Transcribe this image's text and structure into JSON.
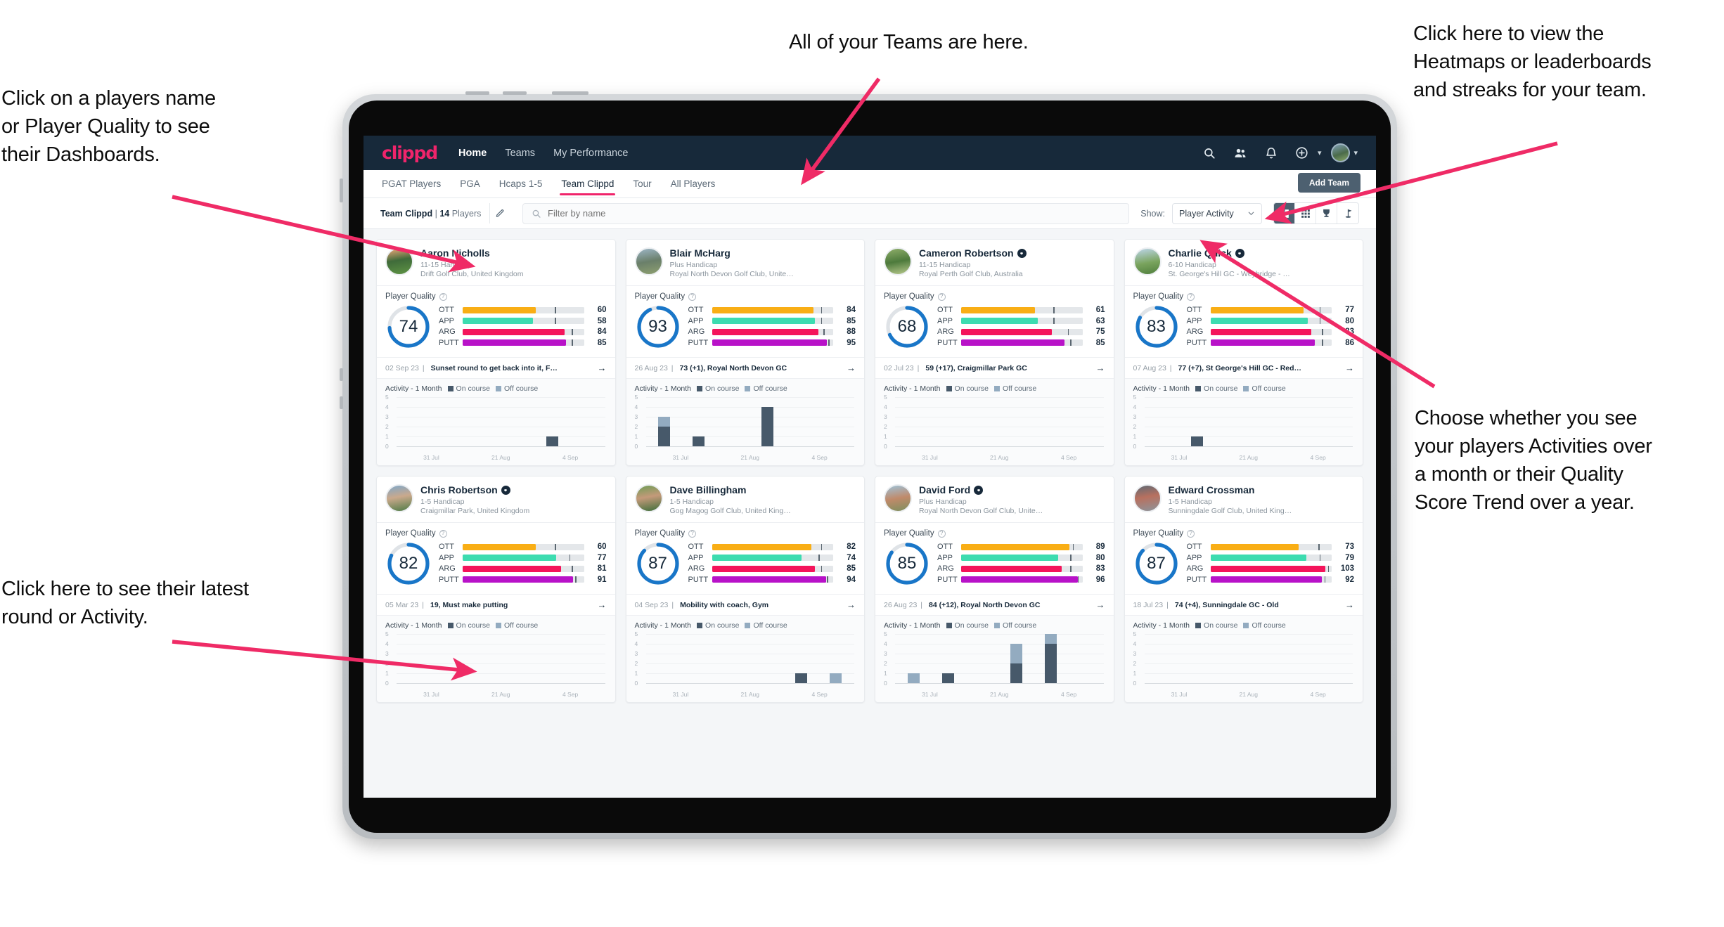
{
  "annotations": [
    {
      "id": "players-name",
      "text": "Click on a players name\nor Player Quality to see\ntheir Dashboards."
    },
    {
      "id": "teams-here",
      "text": "All of your Teams are here."
    },
    {
      "id": "heatmaps",
      "text": "Click here to view the\nHeatmaps or leaderboards\nand streaks for your team."
    },
    {
      "id": "activities-toggle",
      "text": "Choose whether you see\nyour players Activities over\na month or their Quality\nScore Trend over a year."
    },
    {
      "id": "latest-round",
      "text": "Click here to see their latest\nround or Activity."
    }
  ],
  "colors": {
    "brand_pink": "#f0246b",
    "appbar": "#17293a",
    "ott": "#f9ae15",
    "app": "#3ddcb0",
    "arg": "#f4145b",
    "putt": "#b812c8",
    "ring": "#1976c8",
    "ring_track": "#dfe3e7",
    "on_course": "#47596a",
    "off_course": "#93abc0"
  },
  "app": {
    "logo": "clippd",
    "nav": [
      {
        "label": "Home",
        "active": true
      },
      {
        "label": "Teams",
        "active": false
      },
      {
        "label": "My Performance",
        "active": false
      }
    ],
    "header_icons": [
      {
        "name": "search-icon"
      },
      {
        "name": "people-icon"
      },
      {
        "name": "bell-icon"
      },
      {
        "name": "add-circle-icon"
      }
    ],
    "tabs": [
      {
        "label": "PGAT Players",
        "active": false
      },
      {
        "label": "PGA",
        "active": false
      },
      {
        "label": "Hcaps 1-5",
        "active": false
      },
      {
        "label": "Team Clippd",
        "active": true
      },
      {
        "label": "Tour",
        "active": false
      },
      {
        "label": "All Players",
        "active": false
      }
    ],
    "add_team_label": "Add Team",
    "toolbar": {
      "team_name": "Team Clippd",
      "separator": "|",
      "player_count": "14",
      "players_word": "Players",
      "edit_icon": "pencil-icon",
      "search_placeholder": "Filter by name",
      "search_value": "",
      "show_label": "Show:",
      "show_value": "Player Activity",
      "show_options": [
        "Player Activity",
        "Quality Score Trend"
      ],
      "views": [
        {
          "name": "grid-view-icon",
          "active": true
        },
        {
          "name": "dense-grid-view-icon",
          "active": false
        },
        {
          "name": "trophy-view-icon",
          "active": false
        },
        {
          "name": "flag-view-icon",
          "active": false
        }
      ]
    },
    "card_labels": {
      "player_quality": "Player Quality",
      "activity": "Activity - 1 Month",
      "on_course": "On course",
      "off_course": "Off course",
      "metric_labels": [
        "OTT",
        "APP",
        "ARG",
        "PUTT"
      ]
    }
  },
  "chart_data": {
    "type": "bar",
    "title": "Activity - 1 Month",
    "categories": [
      "31 Jul",
      "21 Aug",
      "4 Sep"
    ],
    "x_tick_positions": [
      0,
      3,
      5
    ],
    "ylim": [
      0,
      5
    ],
    "yticks": [
      0,
      1,
      2,
      3,
      4,
      5
    ],
    "grid": true,
    "legend": [
      "On course",
      "Off course"
    ],
    "legend_position": "top",
    "bin_count": 6,
    "per_player": [
      {
        "player": "Aaron Nicholls",
        "on_course": [
          0,
          0,
          0,
          0,
          1,
          0
        ],
        "off_course": [
          0,
          0,
          0,
          0,
          0,
          0
        ]
      },
      {
        "player": "Blair McHarg",
        "on_course": [
          2,
          1,
          0,
          4,
          0,
          0
        ],
        "off_course": [
          1,
          0,
          0,
          0,
          0,
          0
        ]
      },
      {
        "player": "Cameron Robertson",
        "on_course": [
          0,
          0,
          0,
          0,
          0,
          0
        ],
        "off_course": [
          0,
          0,
          0,
          0,
          0,
          0
        ]
      },
      {
        "player": "Charlie Quick",
        "on_course": [
          0,
          1,
          0,
          0,
          0,
          0
        ],
        "off_course": [
          0,
          0,
          0,
          0,
          0,
          0
        ]
      },
      {
        "player": "Chris Robertson",
        "on_course": [
          0,
          0,
          0,
          0,
          0,
          0
        ],
        "off_course": [
          0,
          0,
          0,
          0,
          0,
          0
        ]
      },
      {
        "player": "Dave Billingham",
        "on_course": [
          0,
          0,
          0,
          0,
          1,
          0
        ],
        "off_course": [
          0,
          0,
          0,
          0,
          0,
          1
        ]
      },
      {
        "player": "David Ford",
        "on_course": [
          0,
          1,
          0,
          2,
          4,
          0
        ],
        "off_course": [
          1,
          0,
          0,
          2,
          1,
          0
        ]
      },
      {
        "player": "Edward Crossman",
        "on_course": [
          0,
          0,
          0,
          0,
          0,
          0
        ],
        "off_course": [
          0,
          0,
          0,
          0,
          0,
          0
        ]
      }
    ]
  },
  "players": [
    {
      "name": "Aaron Nicholls",
      "verified": false,
      "handicap": "11-15 Handicap",
      "club": "Drift Golf Club, United Kingdom",
      "quality": 74,
      "metrics": [
        {
          "label": "OTT",
          "value": 60,
          "fill": 60,
          "tick": 76
        },
        {
          "label": "APP",
          "value": 58,
          "fill": 58,
          "tick": 76
        },
        {
          "label": "ARG",
          "value": 84,
          "fill": 84,
          "tick": 90
        },
        {
          "label": "PUTT",
          "value": 85,
          "fill": 85,
          "tick": 90
        }
      ],
      "last_date": "02 Sep 23",
      "last_text": "Sunset round to get back into it, F…"
    },
    {
      "name": "Blair McHarg",
      "verified": false,
      "handicap": "Plus Handicap",
      "club": "Royal North Devon Golf Club, United Kin…",
      "quality": 93,
      "metrics": [
        {
          "label": "OTT",
          "value": 84,
          "fill": 84,
          "tick": 90
        },
        {
          "label": "APP",
          "value": 85,
          "fill": 85,
          "tick": 90
        },
        {
          "label": "ARG",
          "value": 88,
          "fill": 88,
          "tick": 92
        },
        {
          "label": "PUTT",
          "value": 95,
          "fill": 95,
          "tick": 96
        }
      ],
      "last_date": "26 Aug 23",
      "last_text": "73 (+1), Royal North Devon GC"
    },
    {
      "name": "Cameron Robertson",
      "verified": true,
      "handicap": "11-15 Handicap",
      "club": "Royal Perth Golf Club, Australia",
      "quality": 68,
      "metrics": [
        {
          "label": "OTT",
          "value": 61,
          "fill": 61,
          "tick": 76
        },
        {
          "label": "APP",
          "value": 63,
          "fill": 63,
          "tick": 76
        },
        {
          "label": "ARG",
          "value": 75,
          "fill": 75,
          "tick": 88
        },
        {
          "label": "PUTT",
          "value": 85,
          "fill": 85,
          "tick": 90
        }
      ],
      "last_date": "02 Jul 23",
      "last_text": "59 (+17), Craigmillar Park GC"
    },
    {
      "name": "Charlie Quick",
      "verified": true,
      "handicap": "6-10 Handicap",
      "club": "St. George's Hill GC - Weybridge - Surrey, …",
      "quality": 83,
      "metrics": [
        {
          "label": "OTT",
          "value": 77,
          "fill": 77,
          "tick": 90
        },
        {
          "label": "APP",
          "value": 80,
          "fill": 80,
          "tick": 90
        },
        {
          "label": "ARG",
          "value": 83,
          "fill": 83,
          "tick": 92
        },
        {
          "label": "PUTT",
          "value": 86,
          "fill": 86,
          "tick": 92
        }
      ],
      "last_date": "07 Aug 23",
      "last_text": "77 (+7), St George's Hill GC - Red…"
    },
    {
      "name": "Chris Robertson",
      "verified": true,
      "handicap": "1-5 Handicap",
      "club": "Craigmillar Park, United Kingdom",
      "quality": 82,
      "metrics": [
        {
          "label": "OTT",
          "value": 60,
          "fill": 60,
          "tick": 76
        },
        {
          "label": "APP",
          "value": 77,
          "fill": 77,
          "tick": 88
        },
        {
          "label": "ARG",
          "value": 81,
          "fill": 81,
          "tick": 90
        },
        {
          "label": "PUTT",
          "value": 91,
          "fill": 91,
          "tick": 93
        }
      ],
      "last_date": "05 Mar 23",
      "last_text": "19, Must make putting"
    },
    {
      "name": "Dave Billingham",
      "verified": false,
      "handicap": "1-5 Handicap",
      "club": "Gog Magog Golf Club, United Kingdom",
      "quality": 87,
      "metrics": [
        {
          "label": "OTT",
          "value": 82,
          "fill": 82,
          "tick": 90
        },
        {
          "label": "APP",
          "value": 74,
          "fill": 74,
          "tick": 88
        },
        {
          "label": "ARG",
          "value": 85,
          "fill": 85,
          "tick": 90
        },
        {
          "label": "PUTT",
          "value": 94,
          "fill": 94,
          "tick": 95
        }
      ],
      "last_date": "04 Sep 23",
      "last_text": "Mobility with coach, Gym"
    },
    {
      "name": "David Ford",
      "verified": true,
      "handicap": "Plus Handicap",
      "club": "Royal North Devon Golf Club, United Kin…",
      "quality": 85,
      "metrics": [
        {
          "label": "OTT",
          "value": 89,
          "fill": 89,
          "tick": 92
        },
        {
          "label": "APP",
          "value": 80,
          "fill": 80,
          "tick": 90
        },
        {
          "label": "ARG",
          "value": 83,
          "fill": 83,
          "tick": 90
        },
        {
          "label": "PUTT",
          "value": 96,
          "fill": 96,
          "tick": 96
        }
      ],
      "last_date": "26 Aug 23",
      "last_text": "84 (+12), Royal North Devon GC"
    },
    {
      "name": "Edward Crossman",
      "verified": false,
      "handicap": "1-5 Handicap",
      "club": "Sunningdale Golf Club, United Kingdom",
      "quality": 87,
      "metrics": [
        {
          "label": "OTT",
          "value": 73,
          "fill": 73,
          "tick": 89
        },
        {
          "label": "APP",
          "value": 79,
          "fill": 79,
          "tick": 90
        },
        {
          "label": "ARG",
          "value": 103,
          "fill": 95,
          "tick": 97
        },
        {
          "label": "PUTT",
          "value": 92,
          "fill": 92,
          "tick": 94
        }
      ],
      "last_date": "18 Jul 23",
      "last_text": "74 (+4), Sunningdale GC - Old"
    }
  ]
}
